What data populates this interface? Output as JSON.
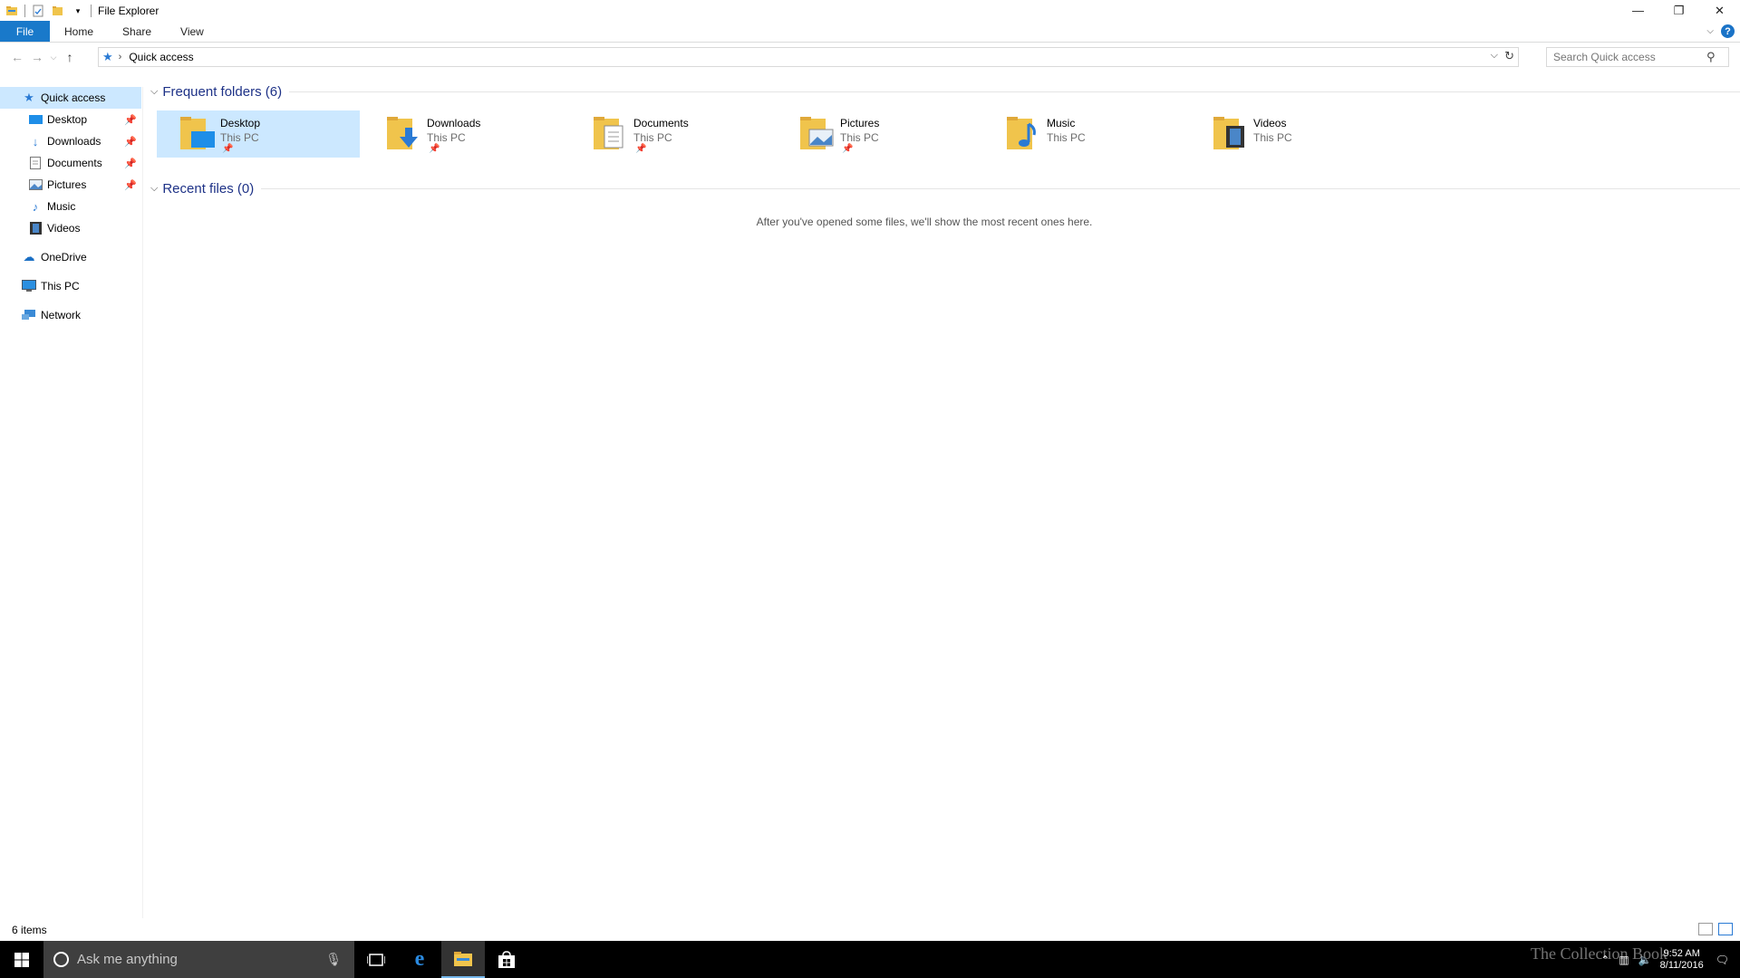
{
  "window": {
    "title": "File Explorer",
    "controls": {
      "minimize": "—",
      "maximize": "❐",
      "close": "✕"
    }
  },
  "ribbon": {
    "tabs": [
      {
        "label": "File"
      },
      {
        "label": "Home"
      },
      {
        "label": "Share"
      },
      {
        "label": "View"
      }
    ],
    "help": "?"
  },
  "address": {
    "path": "Quick access",
    "search_placeholder": "Search Quick access"
  },
  "nav": {
    "quick_access": "Quick access",
    "pinned": [
      {
        "label": "Desktop",
        "pinned": true,
        "icon": "desktop-icon"
      },
      {
        "label": "Downloads",
        "pinned": true,
        "icon": "downloads-icon"
      },
      {
        "label": "Documents",
        "pinned": true,
        "icon": "documents-icon"
      },
      {
        "label": "Pictures",
        "pinned": true,
        "icon": "pictures-icon"
      },
      {
        "label": "Music",
        "pinned": false,
        "icon": "music-icon"
      },
      {
        "label": "Videos",
        "pinned": false,
        "icon": "videos-icon"
      }
    ],
    "onedrive": "OneDrive",
    "this_pc": "This PC",
    "network": "Network"
  },
  "content": {
    "frequent_title": "Frequent folders (6)",
    "folders": [
      {
        "name": "Desktop",
        "location": "This PC",
        "pinned": true
      },
      {
        "name": "Downloads",
        "location": "This PC",
        "pinned": true
      },
      {
        "name": "Documents",
        "location": "This PC",
        "pinned": true
      },
      {
        "name": "Pictures",
        "location": "This PC",
        "pinned": true
      },
      {
        "name": "Music",
        "location": "This PC",
        "pinned": false
      },
      {
        "name": "Videos",
        "location": "This PC",
        "pinned": false
      }
    ],
    "recent_title": "Recent files (0)",
    "recent_empty": "After you've opened some files, we'll show the most recent ones here."
  },
  "status": {
    "item_count": "6 items"
  },
  "taskbar": {
    "search_placeholder": "Ask me anything",
    "time": "9:52 AM",
    "date": "8/11/2016",
    "watermark": "The Collection Book"
  },
  "colors": {
    "accent": "#1979ca",
    "selection": "#cce8ff",
    "folder": "#f0c44c",
    "group_title": "#1e3287"
  }
}
